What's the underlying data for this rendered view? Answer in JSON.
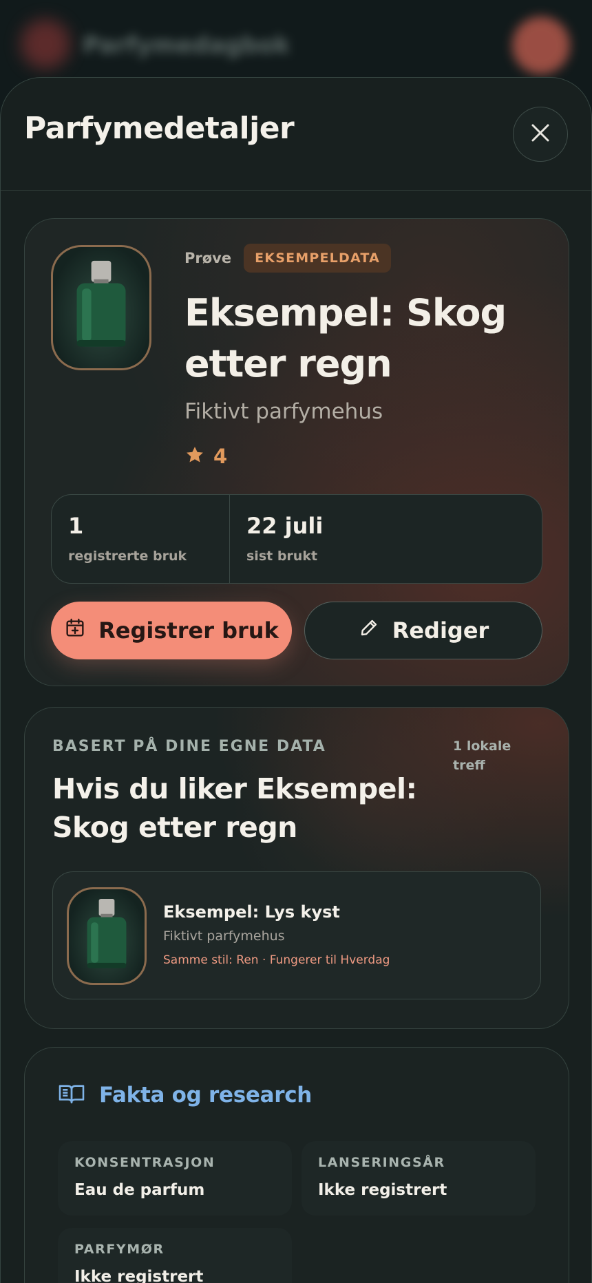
{
  "app": {
    "title": "Parfymedagbok"
  },
  "sheet": {
    "title": "Parfymedetaljer",
    "close_label": "Lukk"
  },
  "perfume": {
    "type": "Prøve",
    "badge": "EKSEMPELDATA",
    "name": "Eksempel: Skog etter regn",
    "brand": "Fiktivt parfymehus",
    "rating": "4"
  },
  "stats": [
    {
      "value": "1",
      "label": "registrerte bruk"
    },
    {
      "value": "22 juli",
      "label": "sist brukt"
    }
  ],
  "actions": {
    "register": "Registrer bruk",
    "edit": "Rediger"
  },
  "recommendations": {
    "eyebrow": "BASERT PÅ DINE EGNE DATA",
    "count": "1 lokale treff",
    "title": "Hvis du liker Eksempel: Skog etter regn",
    "items": [
      {
        "name": "Eksempel: Lys kyst",
        "brand": "Fiktivt parfymehus",
        "reason": "Samme stil: Ren · Fungerer til Hverdag"
      }
    ]
  },
  "facts": {
    "title": "Fakta og research",
    "items": [
      {
        "label": "KONSENTRASJON",
        "value": "Eau de parfum"
      },
      {
        "label": "LANSERINGSÅR",
        "value": "Ikke registrert"
      },
      {
        "label": "PARFYMØR",
        "value": "Ikke registrert"
      }
    ]
  },
  "colors": {
    "accent": "#f48d78",
    "badge_text": "#e8a069",
    "star": "#e29a5d",
    "facts_title": "#7fb3e8"
  },
  "icons": [
    "close-icon",
    "star-icon",
    "calendar-plus-icon",
    "pencil-icon",
    "book-open-icon"
  ]
}
